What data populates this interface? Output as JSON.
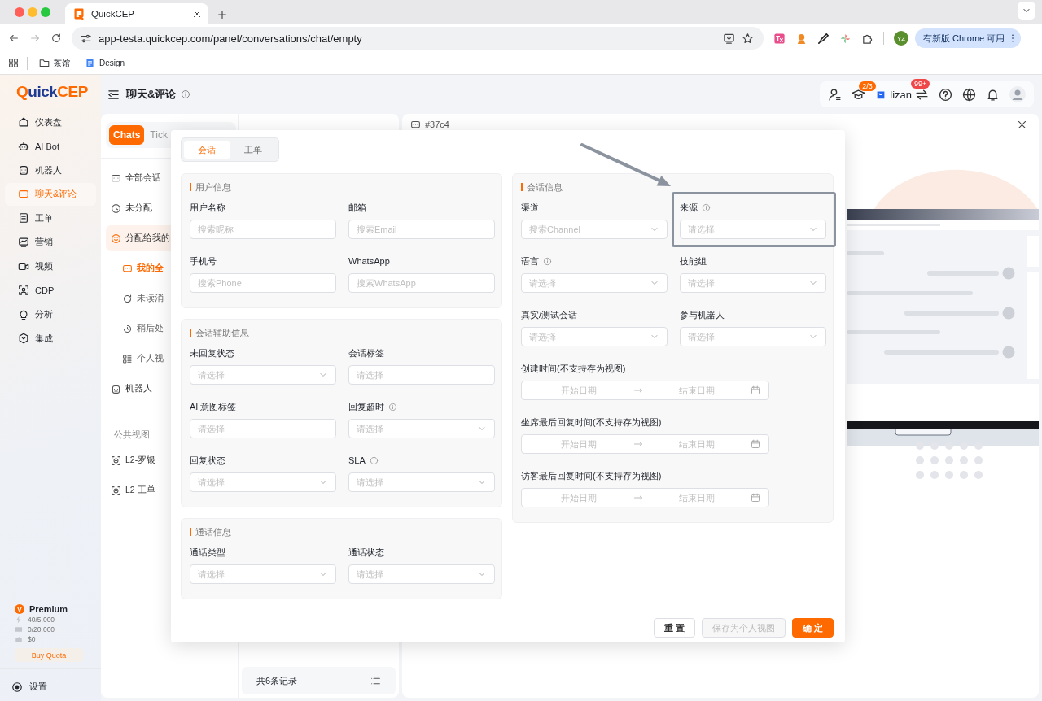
{
  "browser": {
    "tab": {
      "title": "QuickCEP"
    },
    "url": "app-testa.quickcep.com/panel/conversations/chat/empty",
    "profile": "YZ",
    "update_button": "有新版 Chrome 可用",
    "bookmarks": [
      {
        "label": "茶馆",
        "kind": "folder"
      },
      {
        "label": "Design",
        "kind": "doc"
      }
    ]
  },
  "sidebar": {
    "logo": {
      "mark": "Q",
      "name": "uick",
      "suffix": "CEP"
    },
    "items": [
      {
        "label": "仪表盘",
        "selected": false
      },
      {
        "label": "AI Bot",
        "selected": false
      },
      {
        "label": "机器人",
        "selected": false
      },
      {
        "label": "聊天&评论",
        "selected": true
      },
      {
        "label": "工单",
        "selected": false
      },
      {
        "label": "营销",
        "selected": false
      },
      {
        "label": "视频",
        "selected": false
      },
      {
        "label": "CDP",
        "selected": false
      },
      {
        "label": "分析",
        "selected": false
      },
      {
        "label": "集成",
        "selected": false
      }
    ],
    "plan": {
      "badge": "V",
      "name": "Premium",
      "quotas": [
        "40/5,000",
        "0/20,000",
        "$0"
      ],
      "buy_button": "Buy Quota"
    },
    "settings": "设置"
  },
  "header": {
    "title": "聊天&评论",
    "academy_badge": "2/3",
    "user": "lizan",
    "switch_badge": "99+"
  },
  "inbox": {
    "tabs": [
      {
        "label": "Chats",
        "selected": true
      },
      {
        "label": "Tick",
        "selected": false
      }
    ],
    "views": [
      {
        "label": "全部会话",
        "selected": false,
        "expanded": false
      },
      {
        "label": "未分配",
        "selected": false,
        "expanded": false
      },
      {
        "label": "分配给我的",
        "selected": false,
        "expanded": true,
        "children": [
          {
            "label": "我的全",
            "selected": true
          },
          {
            "label": "未读消",
            "selected": false
          },
          {
            "label": "稍后处",
            "selected": false
          },
          {
            "label": "个人视",
            "selected": false
          }
        ]
      },
      {
        "label": "机器人",
        "selected": false,
        "expanded": false
      }
    ],
    "public_views": {
      "title": "公共视图",
      "items": [
        {
          "label": "L2-罗银",
          "selected": false
        },
        {
          "label": "L2 工单",
          "selected": false
        }
      ]
    },
    "footer": "共6条记录"
  },
  "conversation": {
    "title": "#37c4"
  },
  "filter_modal": {
    "tabs": [
      {
        "label": "会话",
        "selected": true
      },
      {
        "label": "工单",
        "selected": false
      }
    ],
    "columns": [
      [
        {
          "title": "用户信息",
          "fields": [
            {
              "label": "用户名称",
              "kind": "text",
              "placeholder": "搜索昵称",
              "info": false
            },
            {
              "label": "邮箱",
              "kind": "text",
              "placeholder": "搜索Email",
              "info": false
            },
            {
              "label": "手机号",
              "kind": "text",
              "placeholder": "搜索Phone",
              "info": false
            },
            {
              "label": "WhatsApp",
              "kind": "text",
              "placeholder": "搜索WhatsApp",
              "info": false
            }
          ]
        },
        {
          "title": "会话辅助信息",
          "fields": [
            {
              "label": "未回复状态",
              "kind": "select",
              "placeholder": "请选择",
              "info": false
            },
            {
              "label": "会话标签",
              "kind": "text",
              "placeholder": "请选择",
              "info": false
            },
            {
              "label": "AI 意图标签",
              "kind": "text",
              "placeholder": "请选择",
              "info": false
            },
            {
              "label": "回复超时",
              "kind": "select",
              "placeholder": "请选择",
              "info": true
            },
            {
              "label": "回复状态",
              "kind": "select",
              "placeholder": "请选择",
              "info": false
            },
            {
              "label": "SLA",
              "kind": "select",
              "placeholder": "请选择",
              "info": true
            }
          ]
        },
        {
          "title": "通话信息",
          "fields": [
            {
              "label": "通话类型",
              "kind": "select",
              "placeholder": "请选择",
              "info": false
            },
            {
              "label": "通话状态",
              "kind": "select",
              "placeholder": "请选择",
              "info": false
            }
          ]
        }
      ],
      [
        {
          "title": "会话信息",
          "fields": [
            {
              "label": "渠道",
              "kind": "select",
              "placeholder": "搜索Channel",
              "info": false
            },
            {
              "label": "来源",
              "kind": "select",
              "placeholder": "请选择",
              "info": true
            },
            {
              "label": "语言",
              "kind": "select",
              "placeholder": "请选择",
              "info": true
            },
            {
              "label": "技能组",
              "kind": "select",
              "placeholder": "请选择",
              "info": false
            },
            {
              "label": "真实/测试会话",
              "kind": "select",
              "placeholder": "请选择",
              "info": false
            },
            {
              "label": "参与机器人",
              "kind": "select",
              "placeholder": "请选择",
              "info": false
            },
            {
              "label": "创建时间(不支持存为视图)",
              "kind": "daterange",
              "start": "开始日期",
              "end": "结束日期",
              "info": false
            },
            {
              "label": "坐席最后回复时间(不支持存为视图)",
              "kind": "daterange",
              "start": "开始日期",
              "end": "结束日期",
              "info": false
            },
            {
              "label": "访客最后回复时间(不支持存为视图)",
              "kind": "daterange",
              "start": "开始日期",
              "end": "结束日期",
              "info": false
            }
          ]
        }
      ]
    ],
    "buttons": [
      {
        "label": "重 置",
        "kind": "default",
        "disabled": false
      },
      {
        "label": "保存为个人视图",
        "kind": "default",
        "disabled": true
      },
      {
        "label": "确 定",
        "kind": "primary",
        "disabled": false
      }
    ]
  }
}
